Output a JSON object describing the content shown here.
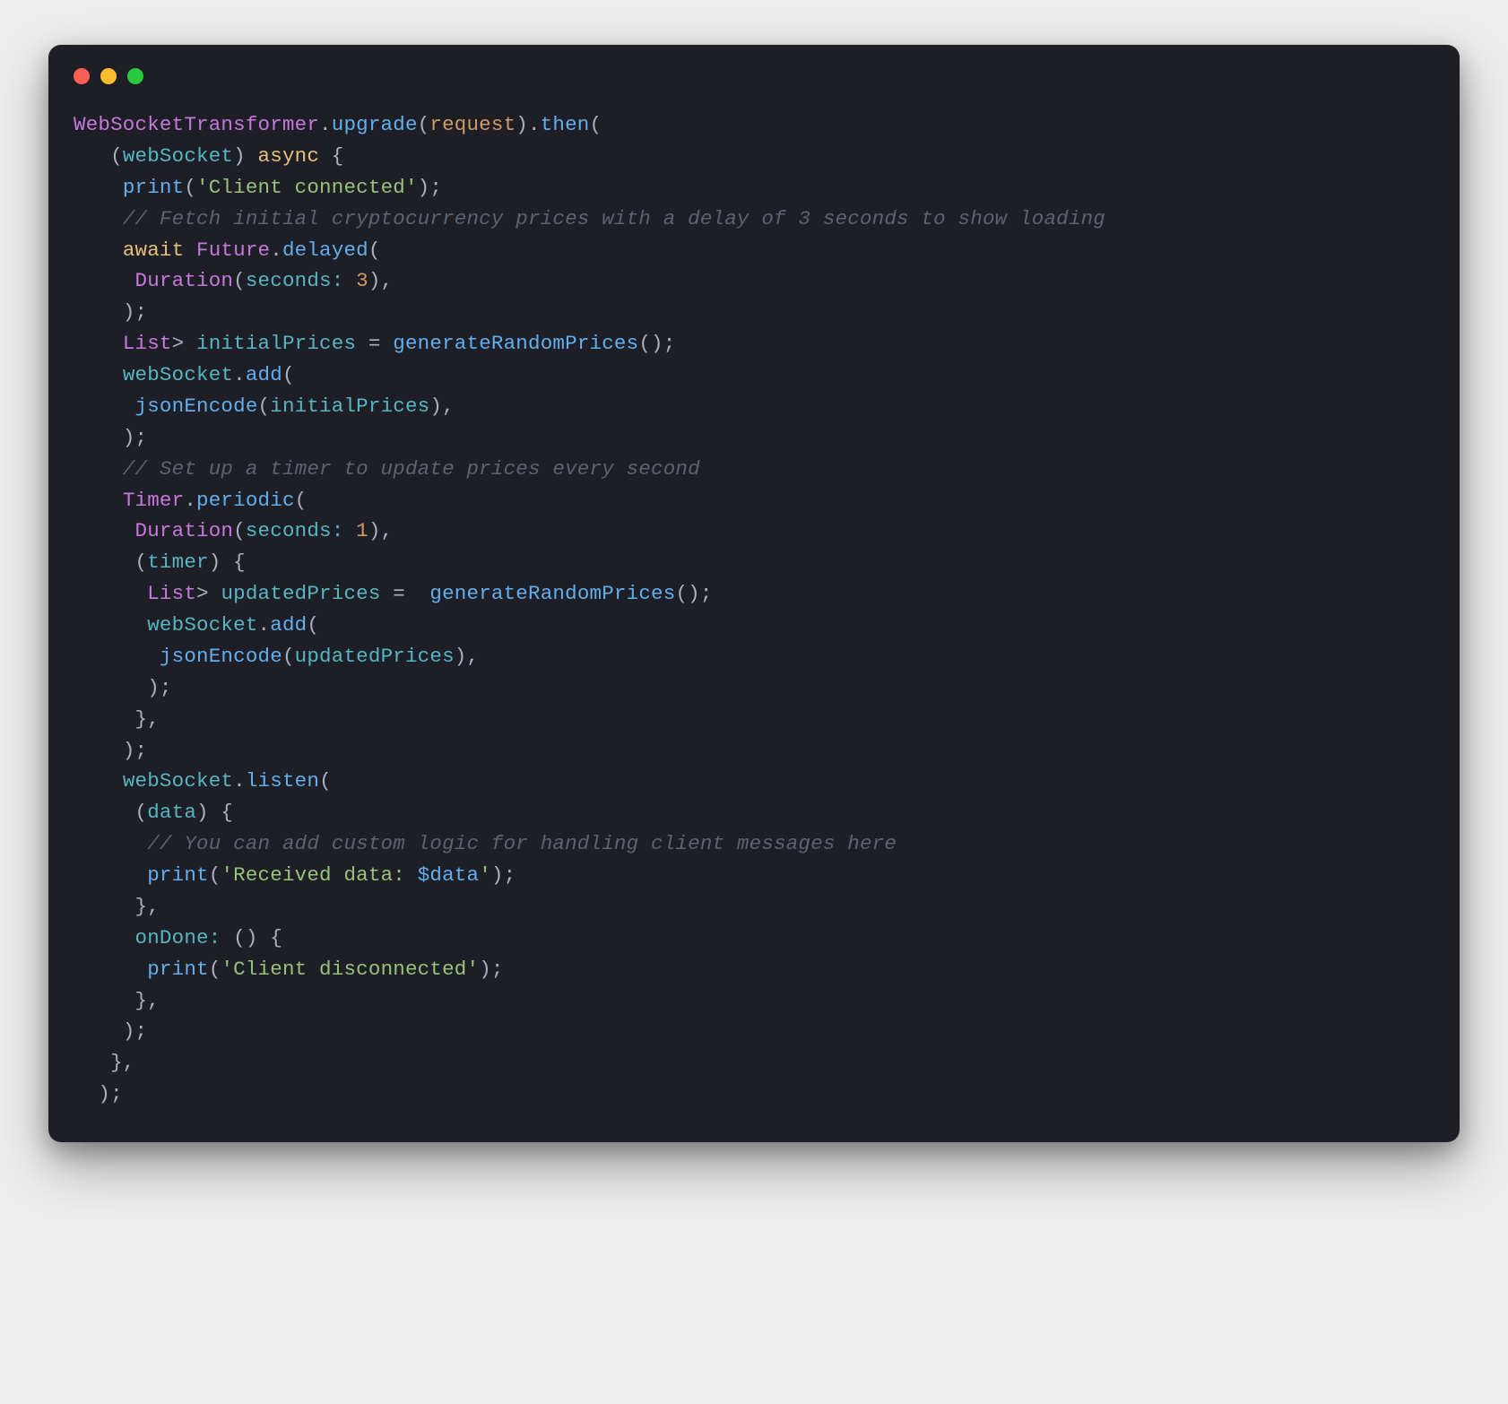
{
  "window": {
    "traffic_lights": [
      "close",
      "minimize",
      "maximize"
    ]
  },
  "syntax_colors": {
    "type": "#c678dd",
    "function": "#61afef",
    "keyword": "#c678dd",
    "variable": "#56b6c2",
    "identifier": "#e5c07b",
    "string": "#98c379",
    "number": "#d19a66",
    "comment": "#5c6370",
    "punctuation": "#abb2bf",
    "background": "#1e1f26"
  },
  "code": {
    "t_WebSocketTransformer": "WebSocketTransformer",
    "t_upgrade": "upgrade",
    "t_request": "request",
    "t_then": "then",
    "t_webSocket": "webSocket",
    "t_async": "async",
    "t_print": "print",
    "s_client_connected": "'Client connected'",
    "c_fetch": "// Fetch initial cryptocurrency prices with a delay of 3 seconds to show loading",
    "t_await": "await",
    "t_Future": "Future",
    "t_delayed": "delayed",
    "t_Duration": "Duration",
    "t_seconds": "seconds:",
    "n_3": "3",
    "t_List": "List",
    "t_gt": ">",
    "t_initialPrices": "initialPrices",
    "t_eq": "=",
    "t_generateRandomPrices": "generateRandomPrices",
    "t_add": "add",
    "t_jsonEncode": "jsonEncode",
    "c_timer": "// Set up a timer to update prices every second",
    "t_Timer": "Timer",
    "t_periodic": "periodic",
    "n_1": "1",
    "t_timer": "timer",
    "t_updatedPrices": "updatedPrices",
    "t_listen": "listen",
    "t_data": "data",
    "c_custom": "// You can add custom logic for handling client messages here",
    "s_received_a": "'Received data: ",
    "t_dollar_data": "$data",
    "s_received_b": "'",
    "t_onDone": "onDone:",
    "s_client_disconnected": "'Client disconnected'"
  }
}
